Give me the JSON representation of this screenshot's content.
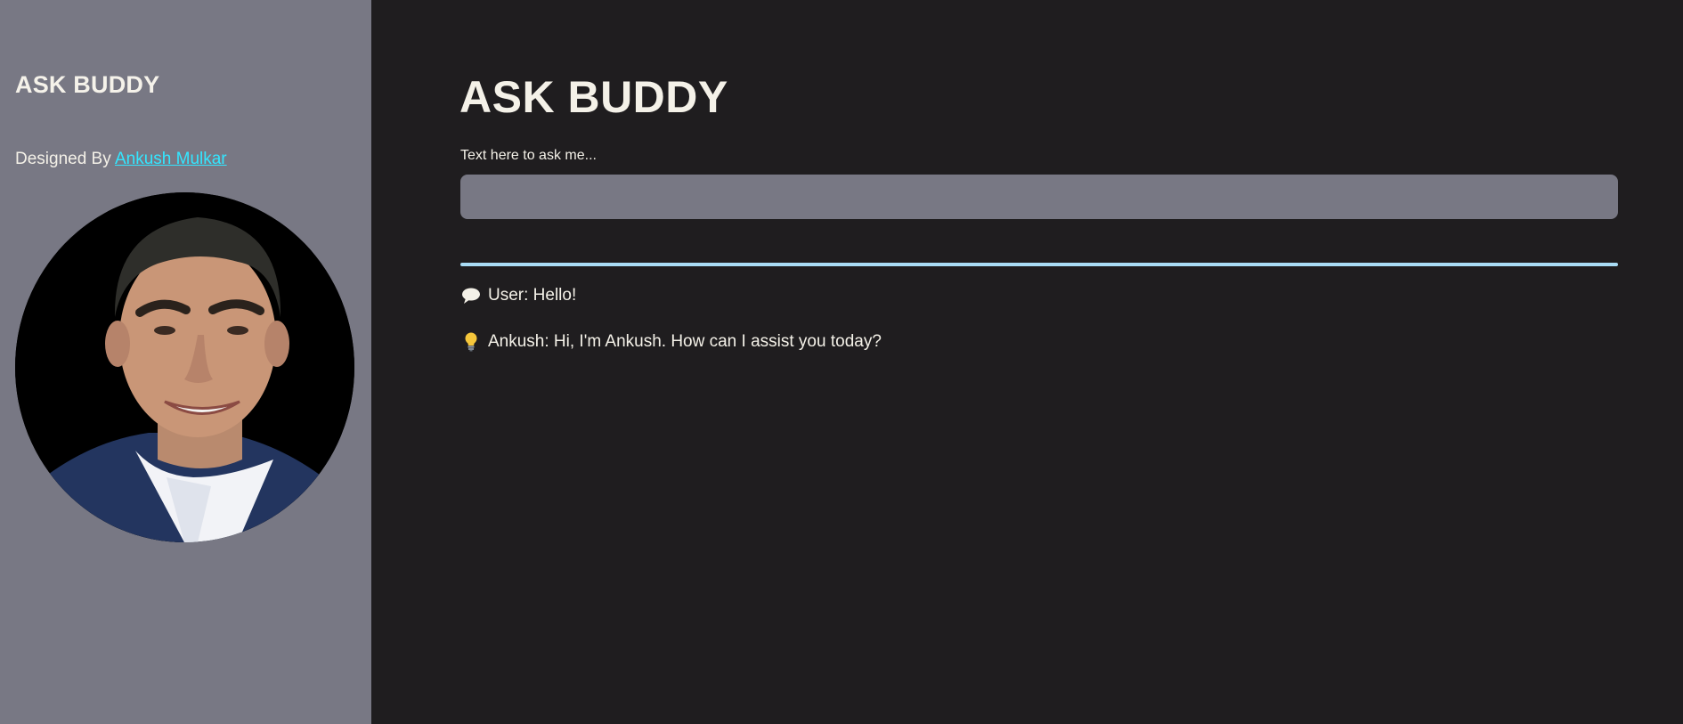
{
  "sidebar": {
    "title": "ASK BUDDY",
    "designed_by_prefix": "Designed By",
    "author_link": "Ankush Mulkar",
    "avatar_alt": "Ankush Mulkar"
  },
  "main": {
    "title": "ASK BUDDY",
    "input_label": "Text here to ask me...",
    "input_value": "",
    "input_placeholder": ""
  },
  "messages": [
    {
      "icon": "speech-bubble-icon",
      "text": "User: Hello!"
    },
    {
      "icon": "lightbulb-icon",
      "text": "Ankush: Hi, I'm Ankush. How can I assist you today?"
    }
  ],
  "colors": {
    "sidebar_bg": "#787884",
    "main_bg": "#1f1d1f",
    "link": "#33e6ff",
    "divider": "#a9dcf5",
    "text": "#f4f1e8"
  }
}
